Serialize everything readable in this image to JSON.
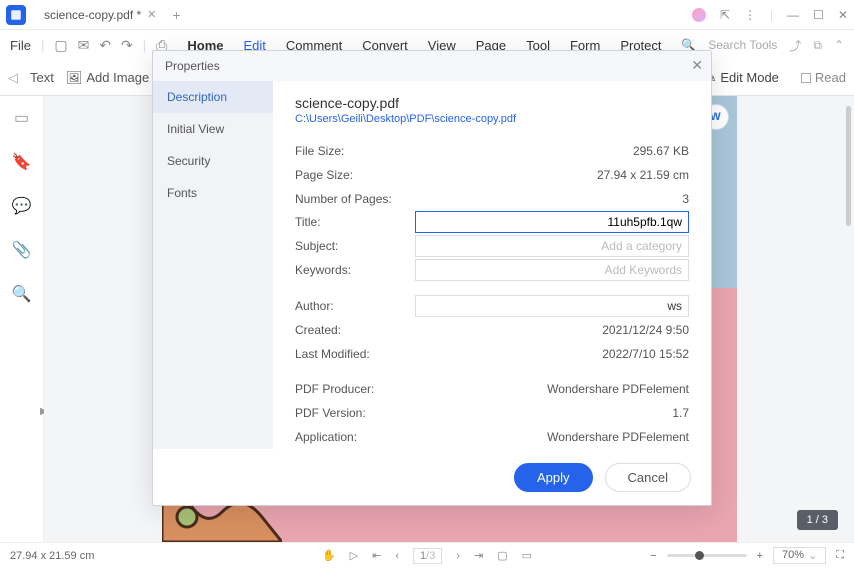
{
  "tab": {
    "title": "science-copy.pdf *"
  },
  "menu": {
    "file": "File",
    "home": "Home",
    "edit": "Edit",
    "comment": "Comment",
    "convert": "Convert",
    "view": "View",
    "page": "Page",
    "tool": "Tool",
    "form": "Form",
    "protect": "Protect",
    "search": "Search Tools"
  },
  "toolbar2": {
    "text": "Text",
    "addimage": "Add Image",
    "editmode": "Edit Mode",
    "read": "Read"
  },
  "modal": {
    "title": "Properties",
    "tabs": {
      "desc": "Description",
      "iview": "Initial View",
      "sec": "Security",
      "fonts": "Fonts"
    },
    "filename": "science-copy.pdf",
    "path": "C:\\Users\\Geili\\Desktop\\PDF\\science-copy.pdf",
    "labels": {
      "filesize": "File Size:",
      "pagesize": "Page Size:",
      "numpages": "Number of Pages:",
      "title": "Title:",
      "subject": "Subject:",
      "keywords": "Keywords:",
      "author": "Author:",
      "created": "Created:",
      "lastmod": "Last Modified:",
      "producer": "PDF Producer:",
      "version": "PDF Version:",
      "application": "Application:"
    },
    "values": {
      "filesize": "295.67 KB",
      "pagesize": "27.94 x 21.59 cm",
      "numpages": "3",
      "title": "11uh5pfb.1qw",
      "subject_ph": "Add a category",
      "keywords_ph": "Add Keywords",
      "author": "ws",
      "created": "2021/12/24 9:50",
      "lastmod": "2022/7/10 15:52",
      "producer": "Wondershare PDFelement",
      "version": "1.7",
      "application": "Wondershare PDFelement"
    },
    "buttons": {
      "apply": "Apply",
      "cancel": "Cancel"
    }
  },
  "status": {
    "dims": "27.94 x 21.59 cm",
    "page": "1",
    "total": "/3",
    "zoom": "70%"
  },
  "pagebadge": "1 / 3"
}
